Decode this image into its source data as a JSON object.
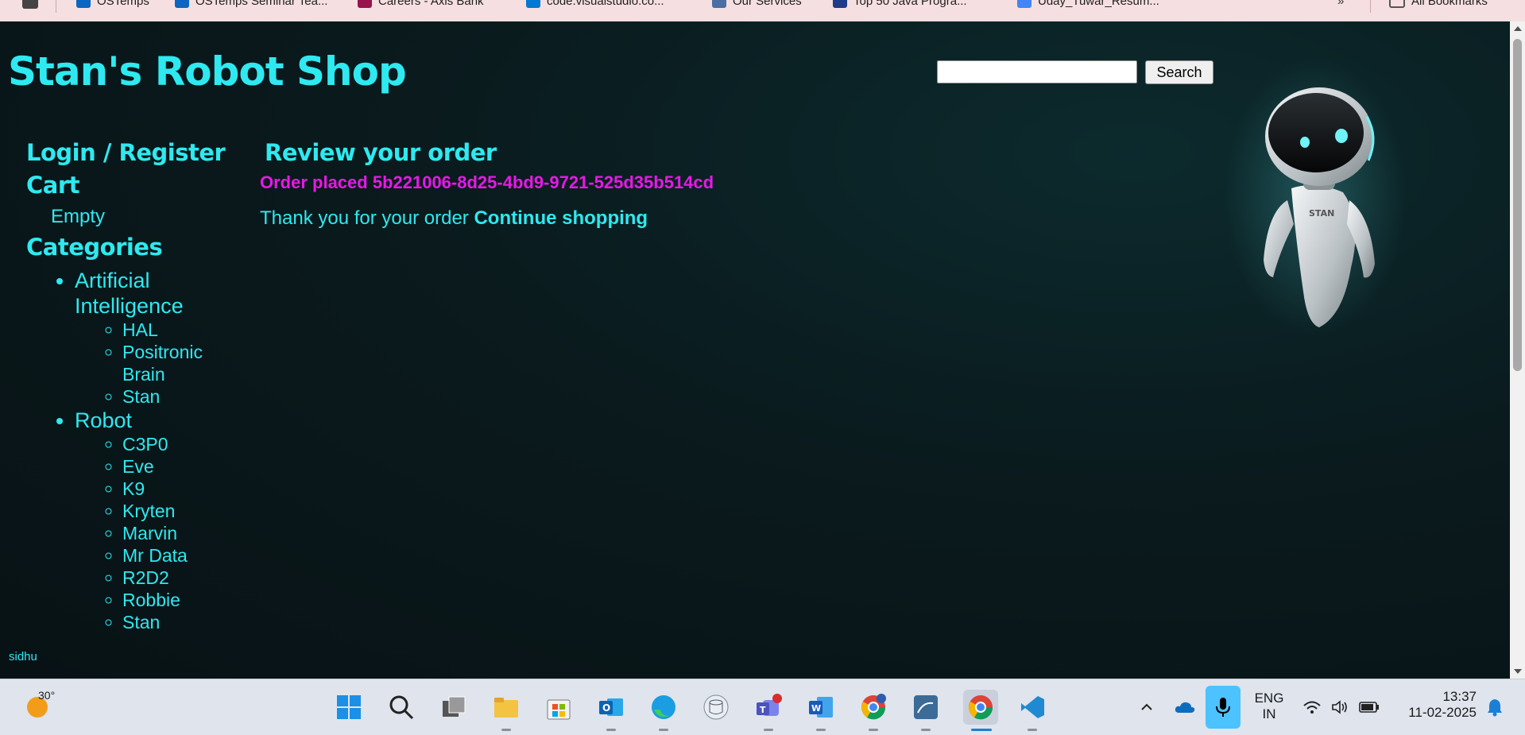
{
  "bookmarks": [
    {
      "label": "OSTemps",
      "color": "#0a66c2"
    },
    {
      "label": "OSTemps Seminar Tea...",
      "color": "#0a66c2"
    },
    {
      "label": "Careers - Axis Bank",
      "color": "#97144d"
    },
    {
      "label": "code.visualstudio.co...",
      "color": "#0078d4"
    },
    {
      "label": "Our Services",
      "color": "#4a6fa5"
    },
    {
      "label": "Top 50 Java Progra...",
      "color": "#1f3c88"
    },
    {
      "label": "Uday_Tuwar_Resum...",
      "color": "#4285f4"
    },
    {
      "label": "All Bookmarks",
      "color": "#555555"
    }
  ],
  "site": {
    "title": "Stan's Robot Shop",
    "search_placeholder": "",
    "search_button": "Search"
  },
  "sidebar": {
    "login_label": "Login / Register",
    "cart_heading": "Cart",
    "cart_status": "Empty",
    "categories_heading": "Categories",
    "categories": [
      {
        "label": "Artificial Intelligence",
        "items": [
          "HAL",
          "Positronic Brain",
          "Stan"
        ]
      },
      {
        "label": "Robot",
        "items": [
          "C3P0",
          "Eve",
          "K9",
          "Kryten",
          "Marvin",
          "Mr Data",
          "R2D2",
          "Robbie",
          "Stan"
        ]
      }
    ]
  },
  "main": {
    "heading": "Review your order",
    "order_placed": "Order placed 5b221006-8d25-4bd9-9721-525d35b514cd",
    "thanks_text": "Thank you for your order",
    "continue_link": "Continue shopping"
  },
  "footer": {
    "user": "sidhu"
  },
  "robot": {
    "badge": "STAN"
  },
  "taskbar": {
    "weather_temp": "30°",
    "apps": [
      "start",
      "search",
      "task-view",
      "file-explorer",
      "microsoft-store",
      "outlook",
      "edge",
      "sql-tool",
      "teams",
      "word",
      "chrome-profile",
      "mysql-workbench",
      "chrome",
      "vscode"
    ],
    "lang_line1": "ENG",
    "lang_line2": "IN",
    "time": "13:37",
    "date": "11-02-2025"
  },
  "colors": {
    "accent": "#2ee9f0",
    "order_highlight": "#e818e8",
    "background": "#0a1a1d"
  }
}
